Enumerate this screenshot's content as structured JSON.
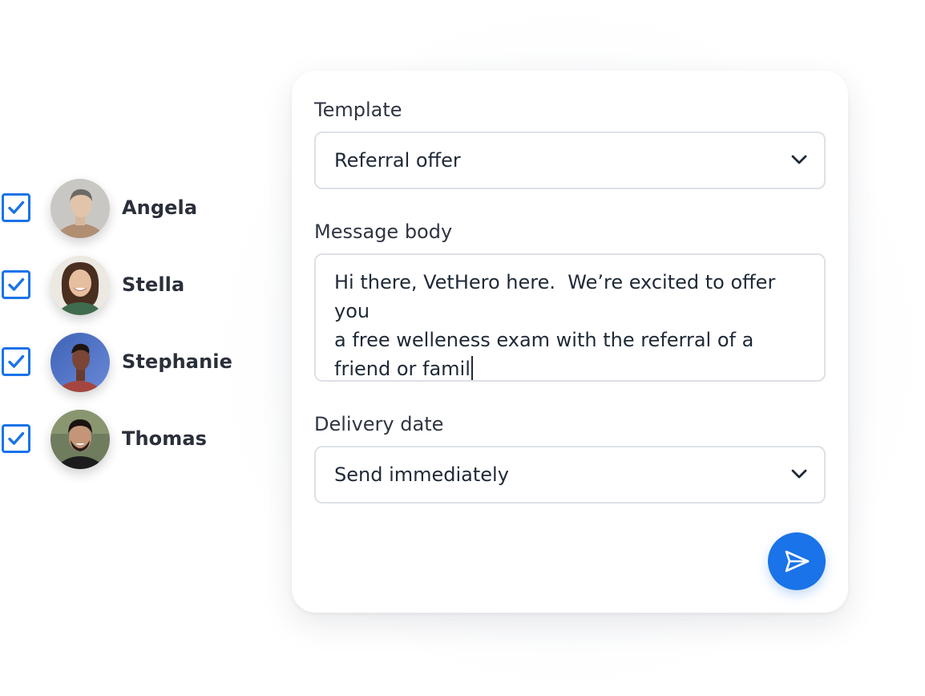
{
  "recipients": [
    {
      "name": "Angela",
      "checked": true
    },
    {
      "name": "Stella",
      "checked": true
    },
    {
      "name": "Stephanie",
      "checked": true
    },
    {
      "name": "Thomas",
      "checked": true
    }
  ],
  "form": {
    "template_label": "Template",
    "template_value": "Referral offer",
    "message_label": "Message body",
    "message_value": "Hi there, VetHero here.  We’re excited to offer you\na free welleness exam with the referral of a\nfriend or famil",
    "delivery_label": "Delivery date",
    "delivery_value": "Send immediately"
  },
  "icons": {
    "checkbox": "checkmark-icon",
    "dropdown": "chevron-down-icon",
    "send": "paper-plane-icon"
  },
  "colors": {
    "accent": "#1a73e8",
    "text": "#1f2937",
    "border": "#dde1e7"
  }
}
